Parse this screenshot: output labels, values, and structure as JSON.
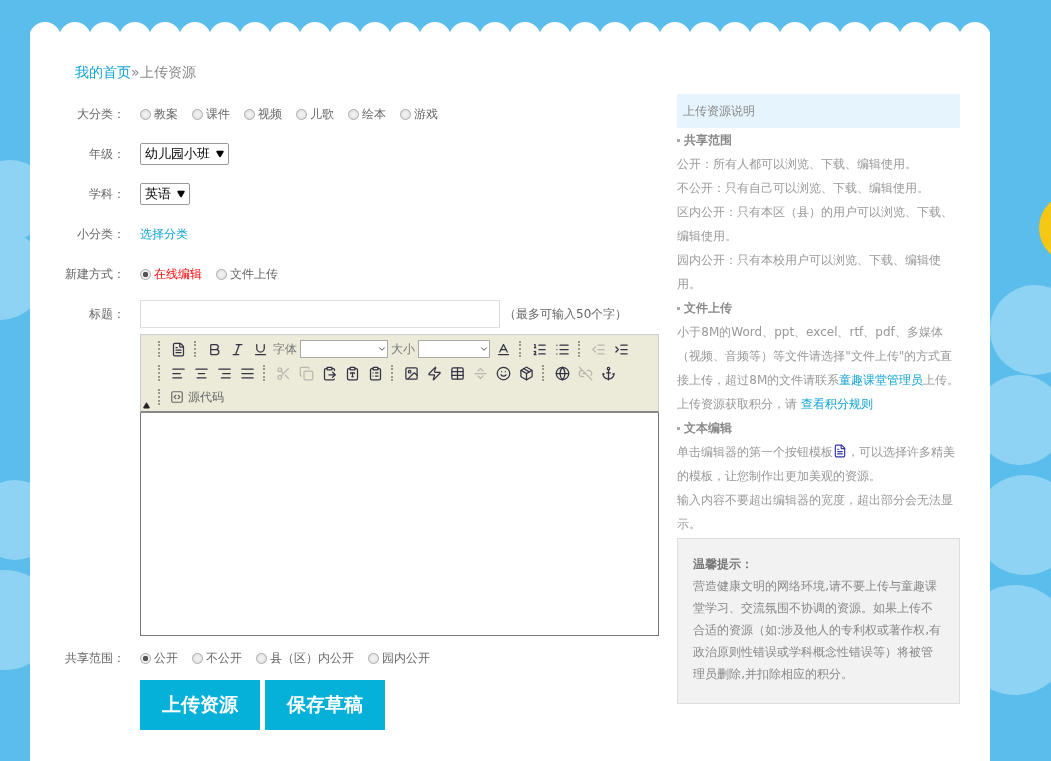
{
  "breadcrumb": {
    "home": "我的首页",
    "separator": "»",
    "current": "上传资源"
  },
  "form": {
    "category": {
      "label": "大分类：",
      "options": [
        {
          "label": "教案",
          "selected": false
        },
        {
          "label": "课件",
          "selected": false
        },
        {
          "label": "视频",
          "selected": false
        },
        {
          "label": "儿歌",
          "selected": false
        },
        {
          "label": "绘本",
          "selected": false
        },
        {
          "label": "游戏",
          "selected": false
        }
      ]
    },
    "grade": {
      "label": "年级：",
      "value": "幼儿园小班"
    },
    "subject": {
      "label": "学科：",
      "value": "英语"
    },
    "subcategory": {
      "label": "小分类：",
      "link": "选择分类"
    },
    "create_mode": {
      "label": "新建方式：",
      "options": [
        {
          "label": "在线编辑",
          "selected": true
        },
        {
          "label": "文件上传",
          "selected": false
        }
      ]
    },
    "title": {
      "label": "标题：",
      "hint": "（最多可输入50个字）"
    },
    "editor": {
      "font_label": "字体",
      "size_label": "大小",
      "source_label": "源代码",
      "buttons": [
        {
          "disabled": false
        },
        {
          "disabled": false
        },
        {
          "disabled": false
        },
        {
          "disabled": false
        },
        {
          "disabled": false
        },
        {
          "disabled": false
        },
        {
          "disabled": false
        },
        {
          "disabled": true
        },
        {
          "disabled": false
        },
        {
          "disabled": false
        },
        {
          "disabled": false
        },
        {
          "disabled": false
        },
        {
          "disabled": false
        },
        {
          "disabled": true
        },
        {
          "disabled": true
        },
        {
          "disabled": false
        },
        {
          "disabled": false
        },
        {
          "disabled": false
        },
        {
          "disabled": false
        },
        {
          "disabled": false
        },
        {
          "disabled": false
        },
        {
          "disabled": true
        },
        {
          "disabled": false
        },
        {
          "disabled": false
        },
        {
          "disabled": false
        },
        {
          "disabled": true
        },
        {
          "disabled": false
        }
      ]
    },
    "share": {
      "label": "共享范围：",
      "options": [
        {
          "label": "公开",
          "selected": true
        },
        {
          "label": "不公开",
          "selected": false
        },
        {
          "label": "县（区）内公开",
          "selected": false
        },
        {
          "label": "园内公开",
          "selected": false
        }
      ]
    },
    "buttons": [
      "上传资源",
      "保存草稿"
    ]
  },
  "sidebar": {
    "title": "上传资源说明",
    "sections": [
      {
        "heading": "共享范围",
        "paragraphs": [
          [
            {
              "kind": "text",
              "text": "公开：所有人都可以浏览、下载、编辑使用。"
            }
          ],
          [
            {
              "kind": "text",
              "text": "不公开：只有自己可以浏览、下载、编辑使用。"
            }
          ],
          [
            {
              "kind": "text",
              "text": "区内公开：只有本区（县）的用户可以浏览、下载、编辑使用。"
            }
          ],
          [
            {
              "kind": "text",
              "text": "园内公开：只有本校用户可以浏览、下载、编辑使用。"
            }
          ]
        ]
      },
      {
        "heading": "文件上传",
        "paragraphs": [
          [
            {
              "kind": "text",
              "text": "小于8M的Word、ppt、excel、rtf、pdf、多媒体（视频、音频等）等文件请选择\"文件上传\"的方式直接上传，超过8M的文件请联系"
            },
            {
              "kind": "link",
              "text": "童趣课堂管理员"
            },
            {
              "kind": "text",
              "text": "上传。"
            }
          ],
          [
            {
              "kind": "text",
              "text": "上传资源获取积分，请 "
            },
            {
              "kind": "link",
              "text": "查看积分规则"
            }
          ]
        ]
      },
      {
        "heading": "文本编辑",
        "paragraphs": [
          [
            {
              "kind": "text",
              "text": "单击编辑器的第一个按钮模板"
            },
            {
              "kind": "icon"
            },
            {
              "kind": "text",
              "text": "，可以选择许多精美的模板，让您制作出更加美观的资源。"
            }
          ],
          [
            {
              "kind": "text",
              "text": "输入内容不要超出编辑器的宽度，超出部分会无法显示。"
            }
          ]
        ]
      }
    ],
    "tip": {
      "title": "温馨提示：",
      "text": "营造健康文明的网络环境,请不要上传与童趣课堂学习、交流氛围不协调的资源。如果上传不合适的资源（如:涉及他人的专利权或著作权,有政治原则性错误或学科概念性错误等）将被管理员删除,并扣除相应的积分。"
    }
  }
}
